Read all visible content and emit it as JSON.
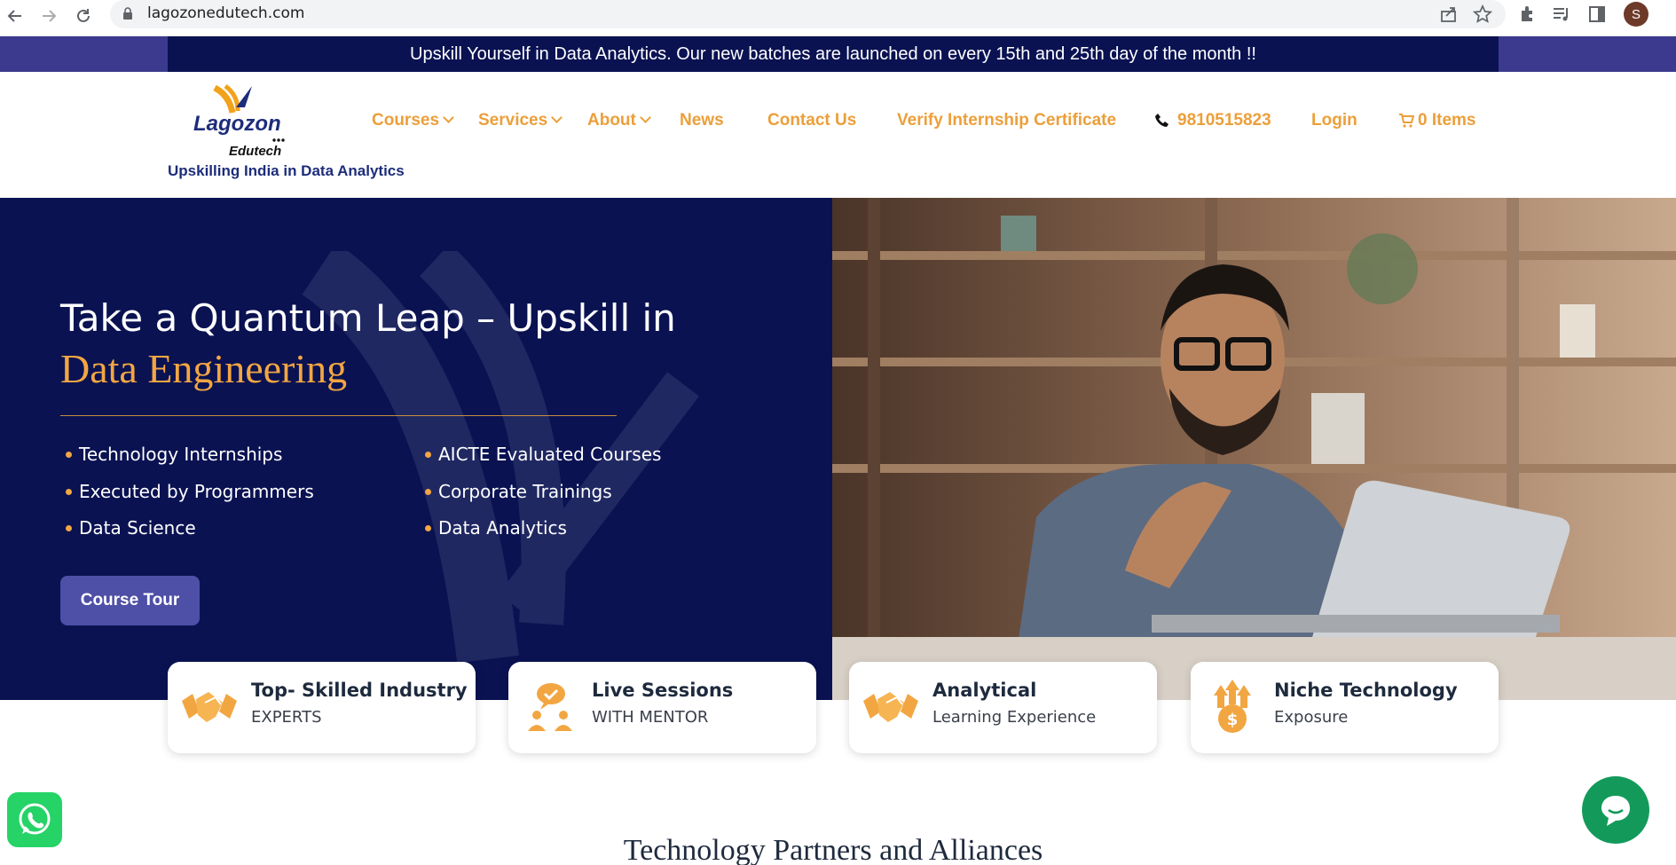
{
  "browser": {
    "url": "lagozonedutech.com",
    "profile_initial": "S"
  },
  "announcement": "Upskill Yourself in Data Analytics. Our new batches are launched on every 15th and 25th day of the month !!",
  "brand": {
    "logo_line1": "Lagozon",
    "logo_line2": "Edutech",
    "tagline": "Upskilling India in Data Analytics"
  },
  "nav": {
    "courses": "Courses",
    "services": "Services",
    "about": "About",
    "news": "News",
    "contact": "Contact Us",
    "verify": "Verify Internship Certificate",
    "phone": "9810515823",
    "login": "Login",
    "cart": "0 Items"
  },
  "hero": {
    "title": "Take a Quantum Leap – Upskill in",
    "subtitle": "Data Engineering",
    "features_left": [
      "Technology Internships",
      "Executed by Programmers",
      "Data Science"
    ],
    "features_right": [
      "AICTE Evaluated Courses",
      "Corporate Trainings",
      "Data Analytics"
    ],
    "button": "Course Tour"
  },
  "cards": [
    {
      "title": "Top- Skilled Industry",
      "sub": "EXPERTS",
      "icon": "handshake-icon"
    },
    {
      "title": "Live Sessions",
      "sub": "WITH MENTOR",
      "icon": "mentor-chat-icon"
    },
    {
      "title": "Analytical",
      "sub": "Learning Experience",
      "icon": "handshake-icon"
    },
    {
      "title": "Niche Technology",
      "sub": "Exposure",
      "icon": "money-growth-icon"
    }
  ],
  "partners_title": "Technology Partners and Alliances",
  "colors": {
    "navy": "#0a1252",
    "accent_orange": "#ec9f3a",
    "button_purple": "#4e4fa6",
    "whatsapp_green": "#25d366",
    "chat_green": "#139a5a"
  }
}
